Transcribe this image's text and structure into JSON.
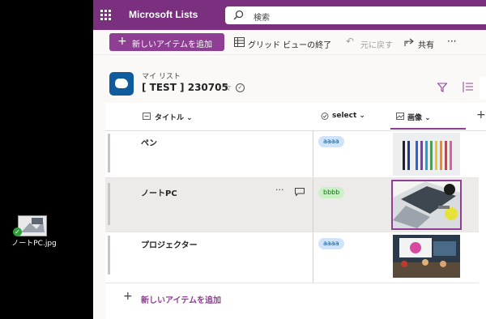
{
  "desktop": {
    "file_label": "ノートPC.jpg",
    "icon": "image-file-icon"
  },
  "app": {
    "title": "Microsoft Lists",
    "search_placeholder": "検索",
    "brand_color": "#7a2f7f"
  },
  "commands": {
    "new_item": "新しいアイテムを追加",
    "exit_grid": "グリッド ビューの終了",
    "undo": "元に戻す",
    "share": "共有",
    "more": "···"
  },
  "list": {
    "breadcrumb": "マイ リスト",
    "title": "[ TEST ] 230705"
  },
  "columns": [
    {
      "label": "タイトル",
      "icon": "text-column-icon"
    },
    {
      "label": "select",
      "icon": "choice-column-icon"
    },
    {
      "label": "画像",
      "icon": "image-column-icon"
    }
  ],
  "rows": [
    {
      "title": "ペン",
      "select": "aaaa",
      "select_color": "#cfe4fa",
      "select_text": "#0f548c",
      "image": "colored pens photo"
    },
    {
      "title": "ノートPC",
      "select": "bbbb",
      "select_color": "#caf0c5",
      "select_text": "#0e700e",
      "image": "laptop desk photo",
      "selected": true
    },
    {
      "title": "プロジェクター",
      "select": "aaaa",
      "select_color": "#cfe4fa",
      "select_text": "#0f548c",
      "image": "meeting room projector photo"
    }
  ],
  "row_more": "···",
  "add_row_label": "新しいアイテムを追加"
}
